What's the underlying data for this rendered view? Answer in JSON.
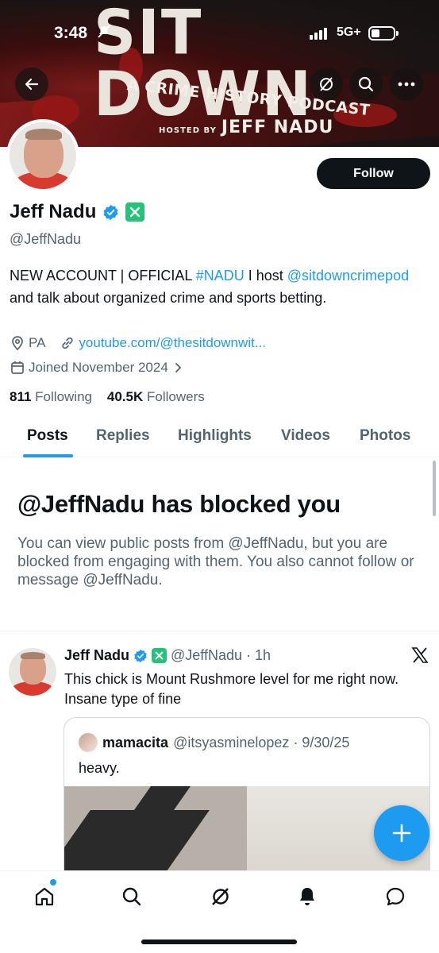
{
  "status_bar": {
    "time": "3:48",
    "network": "5G+"
  },
  "banner": {
    "title": "SIT DOWN",
    "subtitle": "A CRIME HISTORY PODCAST",
    "hosted_by": "HOSTED BY",
    "host_name": "JEFF NADU"
  },
  "profile": {
    "follow_label": "Follow",
    "name": "Jeff Nadu",
    "handle": "@JeffNadu",
    "bio": {
      "part1": "NEW ACCOUNT | OFFICIAL ",
      "hashtag": "#NADU",
      "part2": " I host ",
      "mention": "@sitdowncrimepod",
      "part3": " and talk about organized crime and sports betting."
    },
    "location": "PA",
    "website": "youtube.com/@thesitdownwit...",
    "joined": "Joined November 2024",
    "following_count": "811",
    "following_label": "Following",
    "followers_count": "40.5K",
    "followers_label": "Followers"
  },
  "tabs": [
    "Posts",
    "Replies",
    "Highlights",
    "Videos",
    "Photos"
  ],
  "blocked": {
    "title": "@JeffNadu has blocked you",
    "message": "You can view public posts from @JeffNadu, but you are blocked from engaging with them. You also cannot follow or message @JeffNadu."
  },
  "post": {
    "name": "Jeff Nadu",
    "handle_time": "@JeffNadu · 1h",
    "text": "This chick is Mount Rushmore level for me right now. Insane type of fine",
    "quote": {
      "name": "mamacita",
      "handle_time": "@itsyasminelopez · 9/30/25",
      "text": "heavy."
    }
  },
  "icons": {
    "back": "back-arrow-icon",
    "grok": "grok-icon",
    "search": "search-icon",
    "more": "more-icon",
    "verified": "verified-badge-icon",
    "x": "x-logo-icon",
    "compose": "plus-icon",
    "home": "home-icon",
    "notifications": "bell-icon",
    "messages": "message-icon"
  },
  "colors": {
    "accent": "#1d9bf0",
    "text": "#0f1419",
    "muted": "#536471",
    "badge_green": "#25c27a"
  }
}
